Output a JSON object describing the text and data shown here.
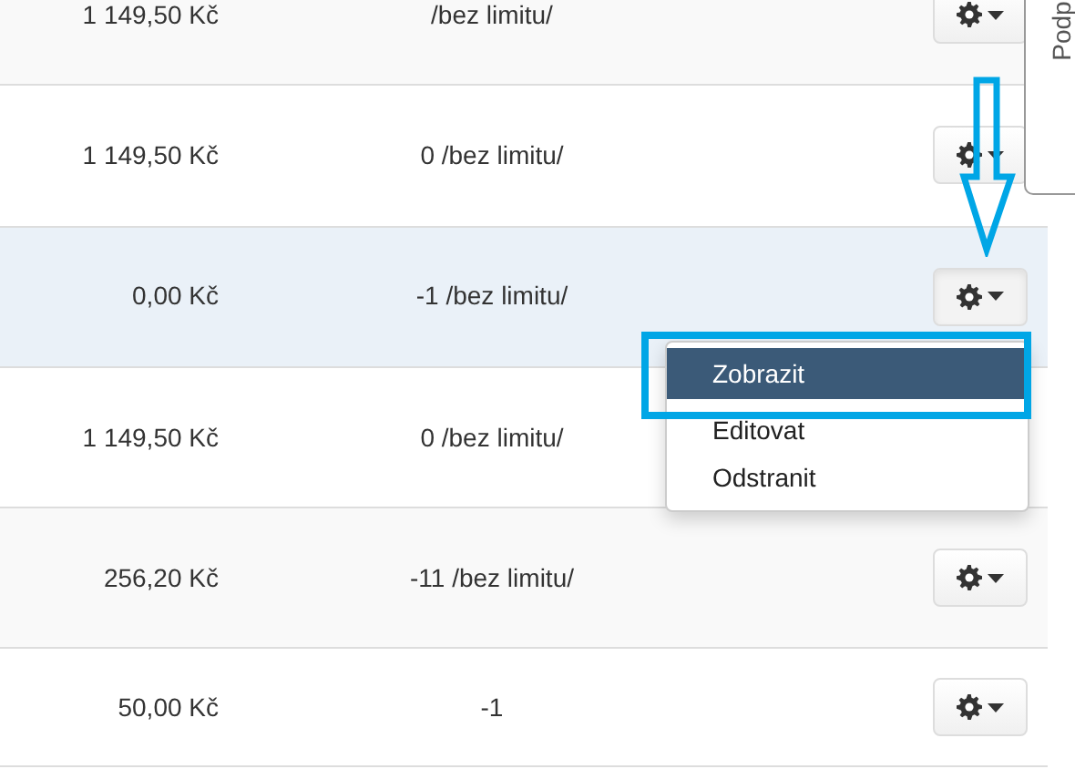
{
  "rows": [
    {
      "price": "1 149,50 Kč",
      "limit": "/bez limitu/",
      "highlighted": false
    },
    {
      "price": "1 149,50 Kč",
      "limit": "0 /bez limitu/",
      "highlighted": false
    },
    {
      "price": "0,00 Kč",
      "limit": "-1 /bez limitu/",
      "highlighted": true,
      "menu_open": true
    },
    {
      "price": "1 149,50 Kč",
      "limit": "0 /bez limitu/",
      "highlighted": false
    },
    {
      "price": "256,20 Kč",
      "limit": "-11 /bez limitu/",
      "highlighted": false
    },
    {
      "price": "50,00 Kč",
      "limit": "-1",
      "highlighted": false
    }
  ],
  "menu": {
    "items": [
      {
        "label": "Zobrazit",
        "selected": true
      },
      {
        "label": "Editovat",
        "selected": false
      },
      {
        "label": "Odstranit",
        "selected": false
      }
    ]
  },
  "side_tab": {
    "label": "Podp"
  }
}
